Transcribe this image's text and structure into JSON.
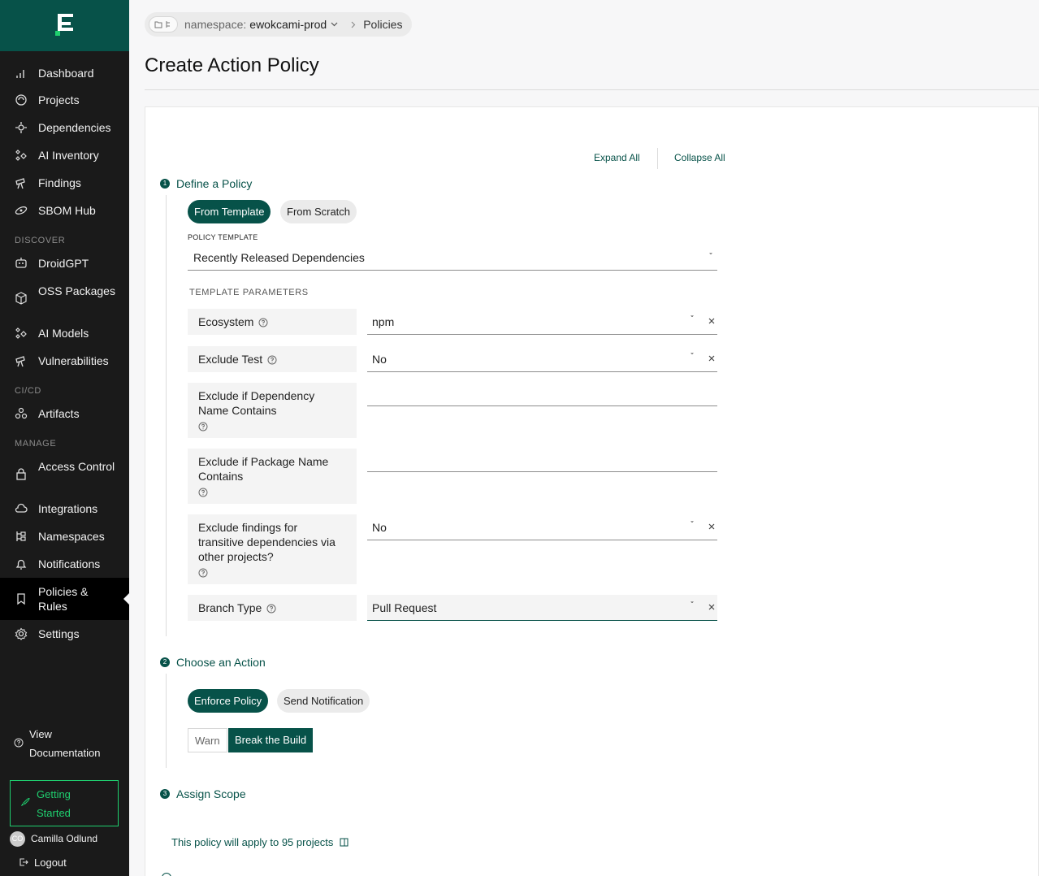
{
  "brand": {
    "accent": "#075249",
    "sidebar_bg": "#1a1a1a",
    "success_green": "#1fcf6f"
  },
  "sidebar": {
    "primary": [
      {
        "label": "Dashboard",
        "icon": "bar-chart-icon"
      },
      {
        "label": "Projects",
        "icon": "projects-icon"
      },
      {
        "label": "Dependencies",
        "icon": "dependencies-icon"
      },
      {
        "label": "AI Inventory",
        "icon": "ai-inventory-icon"
      },
      {
        "label": "Findings",
        "icon": "findings-icon"
      },
      {
        "label": "SBOM Hub",
        "icon": "sbom-icon"
      }
    ],
    "discover": {
      "title": "DISCOVER",
      "items": [
        {
          "label": "DroidGPT",
          "icon": "robot-icon"
        },
        {
          "label": "OSS Packages",
          "icon": "package-icon"
        },
        {
          "label": "AI Models",
          "icon": "ai-models-icon"
        },
        {
          "label": "Vulnerabilities",
          "icon": "telescope-icon"
        }
      ]
    },
    "cicd": {
      "title": "CI/CD",
      "items": [
        {
          "label": "Artifacts",
          "icon": "artifacts-icon"
        }
      ]
    },
    "manage": {
      "title": "MANAGE",
      "items": [
        {
          "label": "Access Control",
          "icon": "lock-icon"
        },
        {
          "label": "Integrations",
          "icon": "cloud-icon"
        },
        {
          "label": "Namespaces",
          "icon": "namespace-icon"
        },
        {
          "label": "Notifications",
          "icon": "bell-icon"
        },
        {
          "label": "Policies & Rules",
          "icon": "bookmark-icon",
          "active": true
        },
        {
          "label": "Settings",
          "icon": "gear-icon"
        }
      ]
    },
    "view_documentation": "View Documentation",
    "getting_started": "Getting Started",
    "user": {
      "initials": "CO",
      "name": "Camilla Odlund"
    },
    "logout": "Logout"
  },
  "breadcrumb": {
    "label": "namespace:",
    "namespace": "ewokcami-prod",
    "current": "Policies"
  },
  "page_title": "Create Action Policy",
  "toolbar": {
    "expand_all": "Expand All",
    "collapse_all": "Collapse All"
  },
  "step1": {
    "number": "1",
    "title": "Define a Policy",
    "tabs": [
      {
        "label": "From Template",
        "selected": true
      },
      {
        "label": "From Scratch",
        "selected": false
      }
    ],
    "template_label": "POLICY TEMPLATE",
    "template_value": "Recently Released Dependencies",
    "params_title": "TEMPLATE PARAMETERS",
    "params": [
      {
        "label": "Ecosystem",
        "value": "npm"
      },
      {
        "label": "Exclude Test",
        "value": "No"
      },
      {
        "label": "Exclude if Dependency Name Contains",
        "value": ""
      },
      {
        "label": "Exclude if Package Name Contains",
        "value": ""
      },
      {
        "label": "Exclude findings for transitive dependencies via other projects?",
        "value": "No"
      },
      {
        "label": "Branch Type",
        "value": "Pull Request"
      }
    ]
  },
  "step2": {
    "number": "2",
    "title": "Choose an Action",
    "tabs": [
      {
        "label": "Enforce Policy",
        "selected": true
      },
      {
        "label": "Send Notification",
        "selected": false
      }
    ],
    "modes": [
      {
        "label": "Warn",
        "selected": false
      },
      {
        "label": "Break the Build",
        "selected": true
      }
    ]
  },
  "step3": {
    "number": "3",
    "title": "Assign Scope",
    "apply_text": "This policy will apply to 95 projects"
  }
}
